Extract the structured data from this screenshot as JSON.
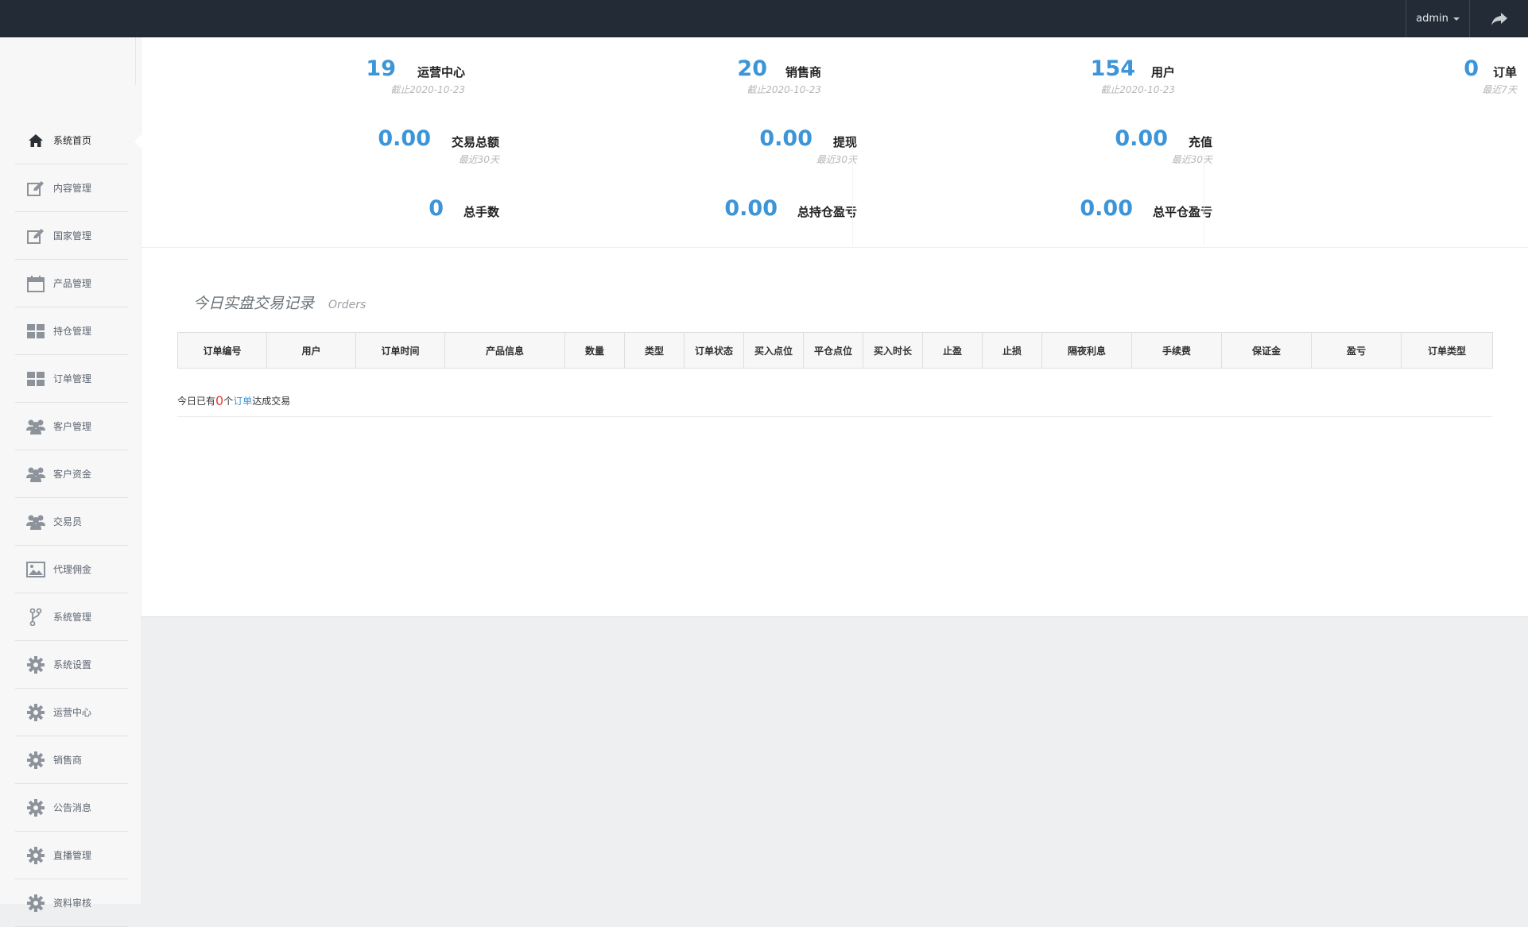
{
  "header": {
    "user_label": "admin",
    "logout_icon": "share-arrow-icon"
  },
  "sidebar": {
    "items": [
      {
        "label": "系统首页",
        "icon": "home-icon",
        "active": true
      },
      {
        "label": "内容管理",
        "icon": "edit-icon"
      },
      {
        "label": "国家管理",
        "icon": "edit-icon"
      },
      {
        "label": "产品管理",
        "icon": "calendar-icon"
      },
      {
        "label": "持仓管理",
        "icon": "grid-icon"
      },
      {
        "label": "订单管理",
        "icon": "grid-icon"
      },
      {
        "label": "客户管理",
        "icon": "users-icon"
      },
      {
        "label": "客户资金",
        "icon": "users-icon"
      },
      {
        "label": "交易员",
        "icon": "users-icon"
      },
      {
        "label": "代理佣金",
        "icon": "image-icon"
      },
      {
        "label": "系统管理",
        "icon": "branch-icon"
      },
      {
        "label": "系统设置",
        "icon": "gear-icon"
      },
      {
        "label": "运营中心",
        "icon": "gear-icon"
      },
      {
        "label": "销售商",
        "icon": "gear-icon"
      },
      {
        "label": "公告消息",
        "icon": "gear-icon"
      },
      {
        "label": "直播管理",
        "icon": "gear-icon"
      },
      {
        "label": "资料审核",
        "icon": "gear-icon"
      }
    ]
  },
  "stats": {
    "row1": [
      {
        "value": "19",
        "label": "运营中心",
        "sub": "截止2020-10-23"
      },
      {
        "value": "20",
        "label": "销售商",
        "sub": "截止2020-10-23"
      },
      {
        "value": "154",
        "label": "用户",
        "sub": "截止2020-10-23"
      },
      {
        "value": "0",
        "label": "订单",
        "sub": "最近7天"
      }
    ],
    "row2": [
      {
        "value": "0.00",
        "label": "交易总额",
        "sub": "最近30天"
      },
      {
        "value": "0.00",
        "label": "提现",
        "sub": "最近30天"
      },
      {
        "value": "0.00",
        "label": "充值",
        "sub": "最近30天"
      }
    ],
    "row3": [
      {
        "value": "0",
        "label": "总手数"
      },
      {
        "value": "0.00",
        "label": "总持仓盈亏"
      },
      {
        "value": "0.00",
        "label": "总平仓盈亏"
      }
    ]
  },
  "orders": {
    "title": "今日实盘交易记录",
    "subtitle": "Orders",
    "columns": [
      "订单编号",
      "用户",
      "订单时间",
      "产品信息",
      "数量",
      "类型",
      "订单状态",
      "买入点位",
      "平仓点位",
      "买入时长",
      "止盈",
      "止损",
      "隔夜利息",
      "手续费",
      "保证金",
      "盈亏",
      "订单类型"
    ],
    "summary_prefix": "今日已有",
    "summary_count": "0",
    "summary_mid": "个",
    "summary_link": "订单",
    "summary_suffix": "达成交易"
  }
}
